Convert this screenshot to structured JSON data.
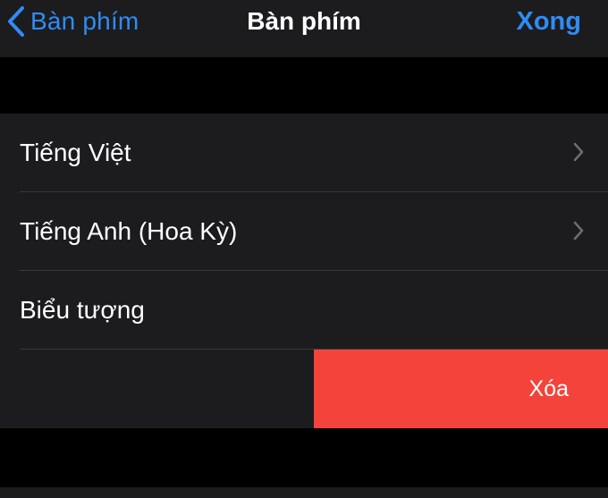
{
  "navbar": {
    "back_label": "Bàn phím",
    "title": "Bàn phím",
    "done_label": "Xong"
  },
  "keyboards": [
    {
      "label": "Tiếng Việt",
      "has_chevron": true
    },
    {
      "label": "Tiếng Anh (Hoa Kỳ)",
      "has_chevron": true
    },
    {
      "label": "Biểu tượng",
      "has_chevron": false
    }
  ],
  "delete_action": {
    "label": "Xóa"
  },
  "colors": {
    "accent": "#2f8cf5",
    "destructive": "#f4433a",
    "row_background": "#1c1c1e",
    "page_background": "#000000"
  },
  "icons": {
    "back": "chevron-left-icon",
    "row_disclosure": "chevron-right-icon"
  }
}
